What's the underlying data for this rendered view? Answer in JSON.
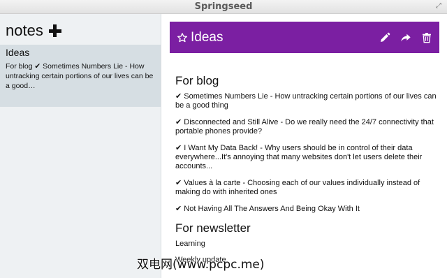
{
  "window": {
    "title": "Springseed"
  },
  "sidebar": {
    "app_name": "notes",
    "notes": [
      {
        "title": "Ideas",
        "excerpt": "For blog ✔ Sometimes Numbers Lie - How untracking certain portions of our lives can be a good…"
      }
    ]
  },
  "note": {
    "title": "Ideas",
    "starred": false,
    "actions": [
      "edit-icon",
      "share-icon",
      "trash-icon"
    ],
    "header_color": "#7b1fa2",
    "sections": [
      {
        "heading": "For blog",
        "items": [
          "✔ Sometimes Numbers Lie - How untracking certain portions of our lives can be a good thing",
          "✔ Disconnected and Still Alive - Do we really need the 24/7 connectivity that portable phones provide?",
          "✔ I Want My Data Back! - Why users should be in control of their data everywhere...It's annoying that many websites don't let users delete their accounts...",
          "✔ Values à la carte - Choosing each of our values individually instead of making do with inherited ones",
          "✔ Not Having All The Answers And Being Okay With It"
        ]
      },
      {
        "heading": "For newsletter",
        "items": [
          "Learning",
          "Weekly update"
        ]
      }
    ]
  },
  "watermark": "双电网(www.pcpc.me)"
}
